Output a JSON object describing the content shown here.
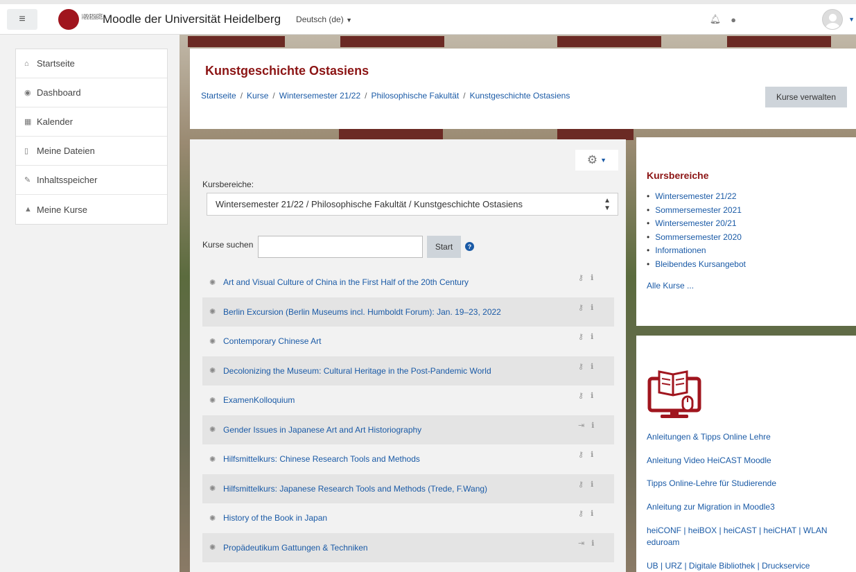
{
  "topbar": {
    "menu_icon": "hamburger-icon",
    "site_name": "Moodle der Universität Heidelberg",
    "logo_text": "UNIVERSITÄT HEIDELBERG ZUKUNFT SEIT 1386",
    "language": "Deutsch (de)",
    "icons": [
      "bell-icon",
      "chat-icon",
      "avatar-icon"
    ]
  },
  "nav": {
    "items": [
      {
        "label": "Startseite",
        "icon": "home-icon"
      },
      {
        "label": "Dashboard",
        "icon": "dashboard-icon"
      },
      {
        "label": "Kalender",
        "icon": "calendar-icon"
      },
      {
        "label": "Meine Dateien",
        "icon": "file-icon"
      },
      {
        "label": "Inhaltsspeicher",
        "icon": "brush-icon"
      },
      {
        "label": "Meine Kurse",
        "icon": "graduation-cap-icon"
      }
    ]
  },
  "header": {
    "title": "Kunstgeschichte Ostasiens",
    "breadcrumb": [
      "Startseite",
      "Kurse",
      "Wintersemester 21/22",
      "Philosophische Fakultät",
      "Kunstgeschichte Ostasiens"
    ],
    "manage_button": "Kurse verwalten"
  },
  "main": {
    "kursbereiche_label": "Kursbereiche:",
    "kursbereiche_selected": "Wintersemester 21/22 / Philosophische Fakultät / Kunstgeschichte Ostasiens",
    "search_label": "Kurse suchen",
    "search_value": "",
    "search_button": "Start",
    "courses": [
      {
        "name": "Art and Visual Culture of China in the First Half of the 20th Century",
        "access": "key"
      },
      {
        "name": "Berlin Excursion (Berlin Museums incl. Humboldt Forum): Jan. 19–23, 2022",
        "access": "key"
      },
      {
        "name": "Contemporary Chinese Art",
        "access": "key"
      },
      {
        "name": "Decolonizing the Museum: Cultural Heritage in the Post-Pandemic World",
        "access": "key"
      },
      {
        "name": "ExamenKolloquium",
        "access": "key"
      },
      {
        "name": "Gender Issues in Japanese Art and Art Historiography",
        "access": "login"
      },
      {
        "name": "Hilfsmittelkurs: Chinese Research Tools and Methods",
        "access": "key"
      },
      {
        "name": "Hilfsmittelkurs: Japanese Research Tools and Methods (Trede, F.Wang)",
        "access": "key"
      },
      {
        "name": "History of the Book in Japan",
        "access": "key"
      },
      {
        "name": "Propädeutikum Gattungen & Techniken",
        "access": "login"
      }
    ]
  },
  "side1": {
    "title": "Kursbereiche",
    "items": [
      "Wintersemester 21/22",
      "Sommersemester 2021",
      "Wintersemester 20/21",
      "Sommersemester 2020",
      "Informationen",
      "Bleibendes Kursangebot"
    ],
    "all_courses": "Alle Kurse ..."
  },
  "side2": {
    "icon": "online-learning-monitor-icon",
    "links": [
      "Anleitungen & Tipps Online Lehre",
      "Anleitung Video HeiCAST Moodle",
      "Tipps Online-Lehre für Studierende",
      "Anleitung zur Migration in Moodle3",
      "heiCONF | heiBOX | heiCAST | heiCHAT | WLAN eduroam",
      "UB | URZ | Digitale Bibliothek |  Druckservice"
    ]
  },
  "colors": {
    "accent": "#8c1515",
    "link": "#1a5aa6"
  }
}
